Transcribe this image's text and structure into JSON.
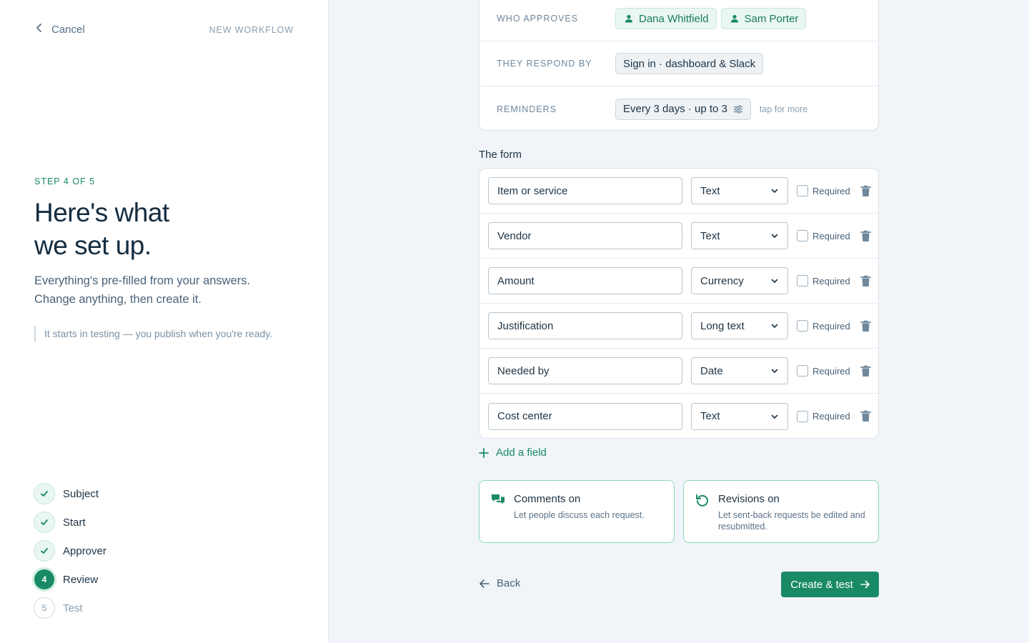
{
  "header": {
    "cancel_label": "Cancel",
    "context_label": "NEW WORKFLOW"
  },
  "intro": {
    "step_label": "STEP 4 OF 5",
    "heading_line1": "Here's what",
    "heading_line2": "we set up.",
    "desc_line1": "Everything's pre-filled from your answers.",
    "desc_line2": "Change anything, then create it.",
    "note": "It starts in testing — you publish when you're ready."
  },
  "steps": [
    {
      "num": "1",
      "label": "Subject",
      "state": "done"
    },
    {
      "num": "2",
      "label": "Start",
      "state": "done"
    },
    {
      "num": "3",
      "label": "Approver",
      "state": "done"
    },
    {
      "num": "4",
      "label": "Review",
      "state": "current"
    },
    {
      "num": "5",
      "label": "Test",
      "state": "todo"
    }
  ],
  "settings": {
    "approvers_label": "WHO APPROVES",
    "approvers": [
      "Dana Whitfield",
      "Sam Porter"
    ],
    "respond_label": "THEY RESPOND BY",
    "respond_value": "Sign in · dashboard & Slack",
    "reminders_label": "REMINDERS",
    "reminders_value": "Every 3 days · up to 3",
    "reminders_hint": "tap for more"
  },
  "form": {
    "title": "The form",
    "required_label": "Required",
    "fields": [
      {
        "name": "Item or service",
        "type": "Text"
      },
      {
        "name": "Vendor",
        "type": "Text"
      },
      {
        "name": "Amount",
        "type": "Currency"
      },
      {
        "name": "Justification",
        "type": "Long text"
      },
      {
        "name": "Needed by",
        "type": "Date"
      },
      {
        "name": "Cost center",
        "type": "Text"
      }
    ],
    "add_field_label": "Add a field"
  },
  "options": {
    "comments_title": "Comments on",
    "comments_desc": "Let people discuss each request.",
    "revisions_title": "Revisions on",
    "revisions_desc": "Let sent-back requests be edited and resubmitted."
  },
  "footer": {
    "back_label": "Back",
    "create_label": "Create & test"
  },
  "colors": {
    "accent": "#1a8a66",
    "accent_light": "#eaf7f1",
    "text": "#1e3344",
    "muted": "#8aa0b3",
    "background": "#f1f5f9"
  }
}
